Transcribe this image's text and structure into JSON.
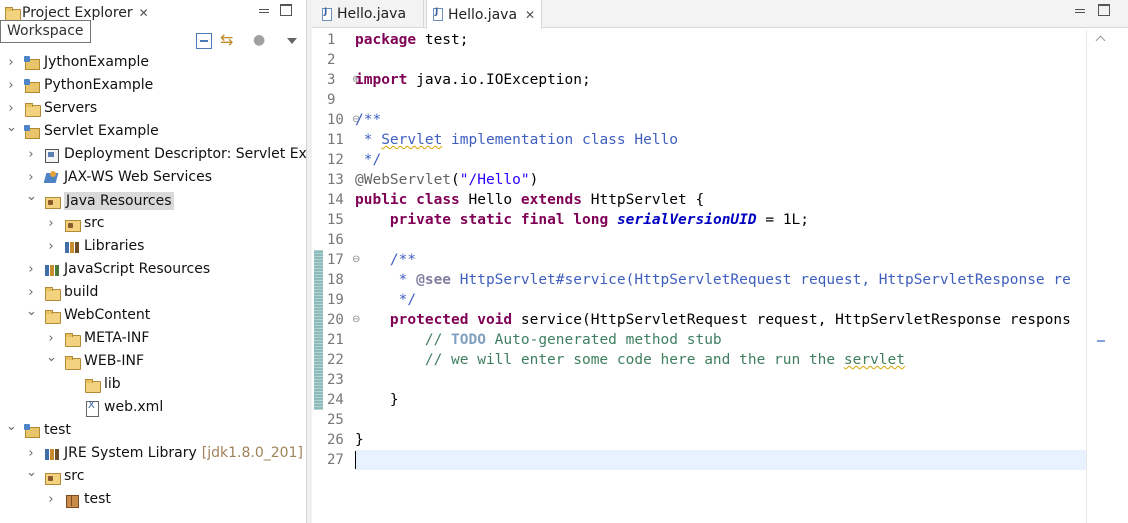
{
  "explorer": {
    "title": "Project Explorer",
    "tooltip": "Workspace",
    "tree": [
      {
        "id": "jython",
        "label": "JythonExample",
        "depth": 0,
        "twisty": "collapsed",
        "icon": "project-icon"
      },
      {
        "id": "python",
        "label": "PythonExample",
        "depth": 0,
        "twisty": "collapsed",
        "icon": "project-icon"
      },
      {
        "id": "servers",
        "label": "Servers",
        "depth": 0,
        "twisty": "collapsed",
        "icon": "folder-icon"
      },
      {
        "id": "servlet-example",
        "label": "Servlet Example",
        "depth": 0,
        "twisty": "expanded",
        "icon": "project-icon"
      },
      {
        "id": "deployment-descriptor",
        "label": "Deployment Descriptor: Servlet Exar",
        "depth": 1,
        "twisty": "collapsed",
        "icon": "deployment-descriptor-icon"
      },
      {
        "id": "jaxws",
        "label": "JAX-WS Web Services",
        "depth": 1,
        "twisty": "collapsed",
        "icon": "web-services-icon"
      },
      {
        "id": "java-resources",
        "label": "Java Resources",
        "depth": 1,
        "twisty": "expanded",
        "icon": "java-resources-icon",
        "selected": true
      },
      {
        "id": "src",
        "label": "src",
        "depth": 2,
        "twisty": "collapsed",
        "icon": "source-folder-icon"
      },
      {
        "id": "libraries",
        "label": "Libraries",
        "depth": 2,
        "twisty": "collapsed",
        "icon": "library-icon"
      },
      {
        "id": "js-resources",
        "label": "JavaScript Resources",
        "depth": 1,
        "twisty": "collapsed",
        "icon": "javascript-resources-icon"
      },
      {
        "id": "build",
        "label": "build",
        "depth": 1,
        "twisty": "collapsed",
        "icon": "folder-icon"
      },
      {
        "id": "webcontent",
        "label": "WebContent",
        "depth": 1,
        "twisty": "expanded",
        "icon": "folder-icon"
      },
      {
        "id": "meta-inf",
        "label": "META-INF",
        "depth": 2,
        "twisty": "collapsed",
        "icon": "folder-icon"
      },
      {
        "id": "web-inf",
        "label": "WEB-INF",
        "depth": 2,
        "twisty": "expanded",
        "icon": "folder-icon"
      },
      {
        "id": "lib",
        "label": "lib",
        "depth": 3,
        "twisty": "none",
        "icon": "folder-icon"
      },
      {
        "id": "web-xml",
        "label": "web.xml",
        "depth": 3,
        "twisty": "none",
        "icon": "xml-file-icon"
      },
      {
        "id": "test",
        "label": "test",
        "depth": 0,
        "twisty": "expanded",
        "icon": "project-icon"
      },
      {
        "id": "jre",
        "label": "JRE System Library",
        "decoration": "[jdk1.8.0_201]",
        "depth": 1,
        "twisty": "collapsed",
        "icon": "library-icon"
      },
      {
        "id": "test-src",
        "label": "src",
        "depth": 1,
        "twisty": "expanded",
        "icon": "source-folder-icon"
      },
      {
        "id": "test-package",
        "label": "test",
        "depth": 2,
        "twisty": "collapsed",
        "icon": "package-icon"
      }
    ]
  },
  "editor": {
    "tabs": [
      {
        "label": "Hello.java",
        "active": false
      },
      {
        "label": "Hello.java",
        "active": true
      }
    ],
    "lines": [
      {
        "n": "1",
        "segs": [
          {
            "t": "package",
            "c": "kw"
          },
          {
            "t": " test;"
          }
        ]
      },
      {
        "n": "2",
        "segs": []
      },
      {
        "n": "3",
        "fold": "plus",
        "segs": [
          {
            "t": "import",
            "c": "kw"
          },
          {
            "t": " java.io.IOException;"
          }
        ]
      },
      {
        "n": "9",
        "segs": []
      },
      {
        "n": "10",
        "fold": "minus",
        "segs": [
          {
            "t": "/**",
            "c": "jd"
          }
        ]
      },
      {
        "n": "11",
        "segs": [
          {
            "t": " * ",
            "c": "jd"
          },
          {
            "t": "Servlet",
            "c": "jd squig"
          },
          {
            "t": " implementation class Hello",
            "c": "jd"
          }
        ]
      },
      {
        "n": "12",
        "segs": [
          {
            "t": " */",
            "c": "jd"
          }
        ]
      },
      {
        "n": "13",
        "segs": [
          {
            "t": "@WebServlet",
            "c": "ann"
          },
          {
            "t": "("
          },
          {
            "t": "\"/Hello\"",
            "c": "str"
          },
          {
            "t": ")"
          }
        ]
      },
      {
        "n": "14",
        "segs": [
          {
            "t": "public",
            "c": "kw"
          },
          {
            "t": " "
          },
          {
            "t": "class",
            "c": "kw"
          },
          {
            "t": " Hello "
          },
          {
            "t": "extends",
            "c": "kw"
          },
          {
            "t": " HttpServlet {"
          }
        ]
      },
      {
        "n": "15",
        "segs": [
          {
            "t": "    "
          },
          {
            "t": "private",
            "c": "kw"
          },
          {
            "t": " "
          },
          {
            "t": "static",
            "c": "kw"
          },
          {
            "t": " "
          },
          {
            "t": "final",
            "c": "kw"
          },
          {
            "t": " "
          },
          {
            "t": "long",
            "c": "kw"
          },
          {
            "t": " "
          },
          {
            "t": "serialVersionUID",
            "c": "fld"
          },
          {
            "t": " = 1L;"
          }
        ]
      },
      {
        "n": "16",
        "segs": []
      },
      {
        "n": "17",
        "fold": "minus",
        "segs": [
          {
            "t": "    /**",
            "c": "jd"
          }
        ]
      },
      {
        "n": "18",
        "segs": [
          {
            "t": "     * ",
            "c": "jd"
          },
          {
            "t": "@see",
            "c": "jdtag"
          },
          {
            "t": " HttpServlet#service(HttpServletRequest request, HttpServletResponse re",
            "c": "jd"
          }
        ]
      },
      {
        "n": "19",
        "segs": [
          {
            "t": "     */",
            "c": "jd"
          }
        ]
      },
      {
        "n": "20",
        "fold": "minus",
        "segs": [
          {
            "t": "    "
          },
          {
            "t": "protected",
            "c": "kw"
          },
          {
            "t": " "
          },
          {
            "t": "void",
            "c": "kw"
          },
          {
            "t": " service(HttpServletRequest request, HttpServletResponse respons"
          }
        ]
      },
      {
        "n": "21",
        "segs": [
          {
            "t": "        // ",
            "c": "cm"
          },
          {
            "t": "TODO",
            "c": "todo"
          },
          {
            "t": " Auto-generated method stub",
            "c": "cm"
          }
        ]
      },
      {
        "n": "22",
        "segs": [
          {
            "t": "        // we will enter some code here and the run the ",
            "c": "cm"
          },
          {
            "t": "servlet",
            "c": "cm squig"
          }
        ]
      },
      {
        "n": "23",
        "segs": []
      },
      {
        "n": "24",
        "segs": [
          {
            "t": "    }"
          }
        ]
      },
      {
        "n": "25",
        "segs": []
      },
      {
        "n": "26",
        "segs": [
          {
            "t": "}"
          }
        ]
      },
      {
        "n": "27",
        "segs": [],
        "current": true
      }
    ]
  }
}
